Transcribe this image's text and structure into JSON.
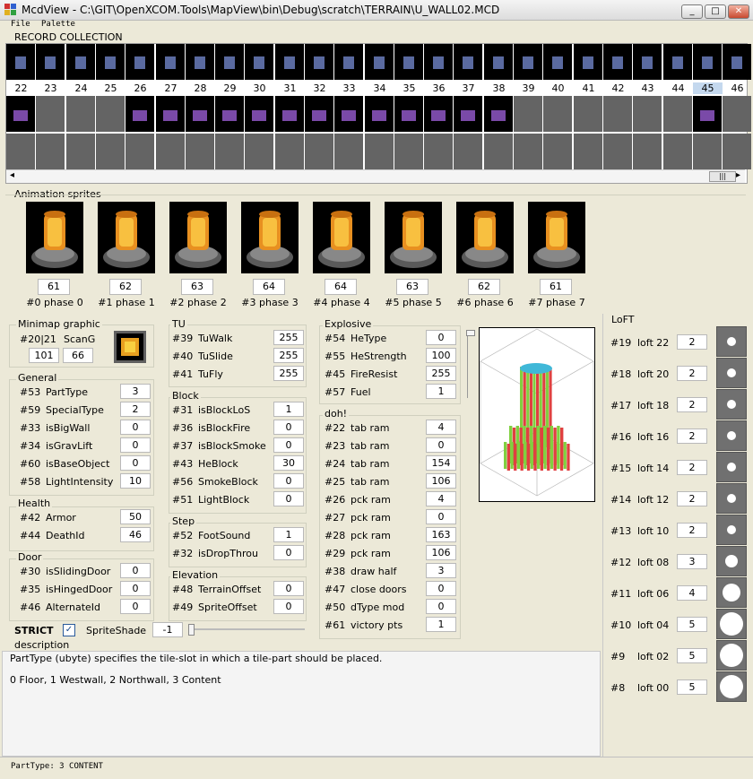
{
  "window": {
    "title": "McdView - C:\\GIT\\OpenXCOM.Tools\\MapView\\bin\\Debug\\scratch\\TERRAIN\\U_WALL02.MCD",
    "minimize_glyph": "_",
    "maximize_glyph": "□",
    "close_glyph": "✕"
  },
  "menu": [
    "File",
    "Palette"
  ],
  "record_collection": {
    "label": "RECORD COLLECTION",
    "numbers": [
      "22",
      "23",
      "24",
      "25",
      "26",
      "27",
      "28",
      "29",
      "30",
      "31",
      "32",
      "33",
      "34",
      "35",
      "36",
      "37",
      "38",
      "39",
      "40",
      "41",
      "42",
      "43",
      "44",
      "45",
      "46"
    ],
    "selected": "45",
    "scroll_left": "◂",
    "scroll_right": "▸",
    "scroll_thumb": "|||"
  },
  "animation": {
    "label": "Animation sprites",
    "values": [
      "61",
      "62",
      "63",
      "64",
      "64",
      "63",
      "62",
      "61"
    ],
    "captions": [
      "#0 phase 0",
      "#1 phase 1",
      "#2 phase 2",
      "#3 phase 3",
      "#4 phase 4",
      "#5 phase 5",
      "#6 phase 6",
      "#7 phase 7"
    ]
  },
  "minimap": {
    "label": "Minimap graphic",
    "id_label": "#20|21",
    "scang_label": "ScanG",
    "value1": "101",
    "value2": "66"
  },
  "general": {
    "label": "General",
    "rows": [
      {
        "id": "#53",
        "name": "PartType",
        "value": "3"
      },
      {
        "id": "#59",
        "name": "SpecialType",
        "value": "2"
      },
      {
        "id": "#33",
        "name": "isBigWall",
        "value": "0"
      },
      {
        "id": "#34",
        "name": "isGravLift",
        "value": "0"
      },
      {
        "id": "#60",
        "name": "isBaseObject",
        "value": "0"
      },
      {
        "id": "#58",
        "name": "LightIntensity",
        "value": "10"
      }
    ]
  },
  "health": {
    "label": "Health",
    "rows": [
      {
        "id": "#42",
        "name": "Armor",
        "value": "50"
      },
      {
        "id": "#44",
        "name": "DeathId",
        "value": "46"
      }
    ]
  },
  "door": {
    "label": "Door",
    "rows": [
      {
        "id": "#30",
        "name": "isSlidingDoor",
        "value": "0"
      },
      {
        "id": "#35",
        "name": "isHingedDoor",
        "value": "0"
      },
      {
        "id": "#46",
        "name": "AlternateId",
        "value": "0"
      }
    ]
  },
  "tu": {
    "label": "TU",
    "rows": [
      {
        "id": "#39",
        "name": "TuWalk",
        "value": "255"
      },
      {
        "id": "#40",
        "name": "TuSlide",
        "value": "255"
      },
      {
        "id": "#41",
        "name": "TuFly",
        "value": "255"
      }
    ]
  },
  "block": {
    "label": "Block",
    "rows": [
      {
        "id": "#31",
        "name": "isBlockLoS",
        "value": "1"
      },
      {
        "id": "#36",
        "name": "isBlockFire",
        "value": "0"
      },
      {
        "id": "#37",
        "name": "isBlockSmoke",
        "value": "0"
      },
      {
        "id": "#43",
        "name": "HeBlock",
        "value": "30"
      },
      {
        "id": "#56",
        "name": "SmokeBlock",
        "value": "0"
      },
      {
        "id": "#51",
        "name": "LightBlock",
        "value": "0"
      }
    ]
  },
  "step": {
    "label": "Step",
    "rows": [
      {
        "id": "#52",
        "name": "FootSound",
        "value": "1"
      },
      {
        "id": "#32",
        "name": "isDropThrou",
        "value": "0"
      }
    ]
  },
  "elevation": {
    "label": "Elevation",
    "rows": [
      {
        "id": "#48",
        "name": "TerrainOffset",
        "value": "0"
      },
      {
        "id": "#49",
        "name": "SpriteOffset",
        "value": "0"
      }
    ]
  },
  "explosive": {
    "label": "Explosive",
    "rows": [
      {
        "id": "#54",
        "name": "HeType",
        "value": "0"
      },
      {
        "id": "#55",
        "name": "HeStrength",
        "value": "100"
      },
      {
        "id": "#45",
        "name": "FireResist",
        "value": "255"
      },
      {
        "id": "#57",
        "name": "Fuel",
        "value": "1"
      }
    ]
  },
  "doh": {
    "label": "doh!",
    "rows": [
      {
        "id": "#22",
        "name": "tab ram",
        "value": "4"
      },
      {
        "id": "#23",
        "name": "tab ram",
        "value": "0"
      },
      {
        "id": "#24",
        "name": "tab ram",
        "value": "154"
      },
      {
        "id": "#25",
        "name": "tab ram",
        "value": "106"
      },
      {
        "id": "#26",
        "name": "pck ram",
        "value": "4"
      },
      {
        "id": "#27",
        "name": "pck ram",
        "value": "0"
      },
      {
        "id": "#28",
        "name": "pck ram",
        "value": "163"
      },
      {
        "id": "#29",
        "name": "pck ram",
        "value": "106"
      },
      {
        "id": "#38",
        "name": "draw half",
        "value": "3"
      },
      {
        "id": "#47",
        "name": "close doors",
        "value": "0"
      },
      {
        "id": "#50",
        "name": "dType mod",
        "value": "0"
      },
      {
        "id": "#61",
        "name": "victory pts",
        "value": "1"
      }
    ]
  },
  "loft": {
    "label": "LoFT",
    "rows": [
      {
        "id": "#19",
        "name": "loft 22",
        "value": "2",
        "dot": "small"
      },
      {
        "id": "#18",
        "name": "loft 20",
        "value": "2",
        "dot": "small"
      },
      {
        "id": "#17",
        "name": "loft 18",
        "value": "2",
        "dot": "small"
      },
      {
        "id": "#16",
        "name": "loft 16",
        "value": "2",
        "dot": "small"
      },
      {
        "id": "#15",
        "name": "loft 14",
        "value": "2",
        "dot": "small"
      },
      {
        "id": "#14",
        "name": "loft 12",
        "value": "2",
        "dot": "small"
      },
      {
        "id": "#13",
        "name": "loft 10",
        "value": "2",
        "dot": "small"
      },
      {
        "id": "#12",
        "name": "loft 08",
        "value": "3",
        "dot": "medium"
      },
      {
        "id": "#11",
        "name": "loft 06",
        "value": "4",
        "dot": "large"
      },
      {
        "id": "#10",
        "name": "loft 04",
        "value": "5",
        "dot": "xlarge"
      },
      {
        "id": "#9",
        "name": "loft 02",
        "value": "5",
        "dot": "xlarge"
      },
      {
        "id": "#8",
        "name": "loft 00",
        "value": "5",
        "dot": "xlarge"
      }
    ]
  },
  "strict": {
    "label": "STRICT",
    "checked": true
  },
  "spriteshade": {
    "label": "SpriteShade",
    "value": "-1"
  },
  "description": {
    "label": "description",
    "line1": "PartType (ubyte) specifies the tile-slot in which a tile-part should be placed.",
    "line2": "0 Floor, 1 Westwall, 2 Northwall, 3 Content"
  },
  "status": {
    "text": "PartType: 3 CONTENT"
  },
  "colors": {
    "selected_record": "#c4d8ee",
    "empty_tile": "#646464",
    "loft_bg": "#707070"
  }
}
